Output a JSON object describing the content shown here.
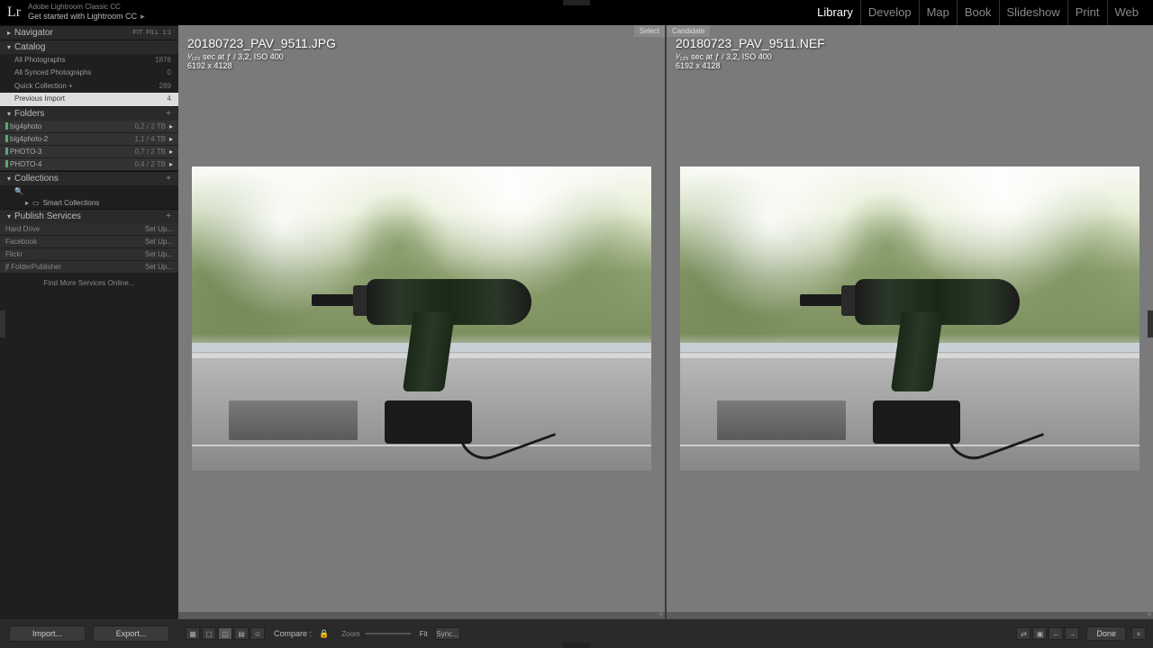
{
  "header": {
    "logo": "Lr",
    "app_title": "Adobe Lightroom Classic CC",
    "get_started": "Get started with Lightroom CC",
    "modules": [
      "Library",
      "Develop",
      "Map",
      "Book",
      "Slideshow",
      "Print",
      "Web"
    ],
    "active_module": "Library"
  },
  "sidebar": {
    "navigator": {
      "label": "Navigator",
      "fit": "FIT",
      "fill": "FILL",
      "one": "1:1"
    },
    "catalog": {
      "label": "Catalog",
      "items": [
        {
          "label": "All Photographs",
          "count": "1876"
        },
        {
          "label": "All Synced Photographs",
          "count": "0"
        },
        {
          "label": "Quick Collection  +",
          "count": "289"
        },
        {
          "label": "Previous Import",
          "count": "4"
        }
      ],
      "selected_index": 3
    },
    "folders": {
      "label": "Folders",
      "items": [
        {
          "name": "big4photo",
          "size": "0,2 / 2 TB"
        },
        {
          "name": "big4photo-2",
          "size": "1,1 / 4 TB"
        },
        {
          "name": "PHOTO-3",
          "size": "0,7 / 2 TB"
        },
        {
          "name": "PHOTO-4",
          "size": "0,4 / 2 TB"
        }
      ]
    },
    "collections": {
      "label": "Collections",
      "smart": "Smart Collections"
    },
    "publish": {
      "label": "Publish Services",
      "items": [
        {
          "name": "Hard Drive",
          "action": "Set Up..."
        },
        {
          "name": "Facebook",
          "action": "Set Up..."
        },
        {
          "name": "Flickr",
          "action": "Set Up..."
        },
        {
          "name": "jf FolderPublisher",
          "action": "Set Up..."
        }
      ],
      "find_more": "Find More Services Online..."
    }
  },
  "compare": {
    "select": {
      "tag": "Select",
      "filename": "20180723_PAV_9511.JPG",
      "exposure": "¹⁄₁₂₅ sec at ƒ / 3,2, ISO 400",
      "dimensions": "6192 x 4128"
    },
    "candidate": {
      "tag": "Candidate",
      "filename": "20180723_PAV_9511.NEF",
      "exposure": "¹⁄₁₂₅ sec at ƒ / 3,2, ISO 400",
      "dimensions": "6192 x 4128"
    }
  },
  "toolbar": {
    "compare_label": "Compare :",
    "zoom_label": "Zoom",
    "fit_label": "Fit",
    "sync_label": "Sync...",
    "done_label": "Done"
  },
  "bottom": {
    "import_label": "Import...",
    "export_label": "Export..."
  }
}
